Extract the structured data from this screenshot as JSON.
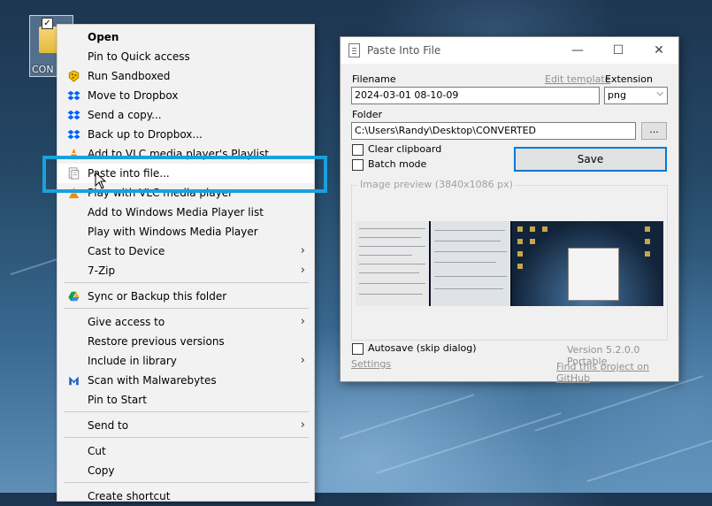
{
  "desktop": {
    "icon_label": "CON"
  },
  "context_menu": {
    "items": [
      {
        "label": "Open",
        "icon": "none"
      },
      {
        "label": "Pin to Quick access",
        "icon": "none"
      },
      {
        "label": "Run Sandboxed",
        "icon": "sandboxie-icon"
      },
      {
        "label": "Move to Dropbox",
        "icon": "dropbox-icon"
      },
      {
        "label": "Send a copy...",
        "icon": "dropbox-icon"
      },
      {
        "label": "Back up to Dropbox...",
        "icon": "dropbox-icon"
      },
      {
        "label": "Add to VLC media player's Playlist",
        "icon": "vlc-icon"
      },
      {
        "label": "Paste into file...",
        "icon": "paste-into-file-icon"
      },
      {
        "label": "Play with VLC media player",
        "icon": "vlc-icon"
      },
      {
        "label": "Add to Windows Media Player list",
        "icon": "none"
      },
      {
        "label": "Play with Windows Media Player",
        "icon": "none"
      },
      {
        "label": "Cast to Device",
        "icon": "none",
        "submenu": true
      },
      {
        "label": "7-Zip",
        "icon": "none",
        "submenu": true
      },
      {
        "label": "Sync or Backup this folder",
        "icon": "google-drive-icon"
      },
      {
        "label": "Give access to",
        "icon": "none",
        "submenu": true
      },
      {
        "label": "Restore previous versions",
        "icon": "none"
      },
      {
        "label": "Include in library",
        "icon": "none",
        "submenu": true
      },
      {
        "label": "Scan with Malwarebytes",
        "icon": "malwarebytes-icon"
      },
      {
        "label": "Pin to Start",
        "icon": "none"
      },
      {
        "label": "Send to",
        "icon": "none",
        "submenu": true
      },
      {
        "label": "Cut",
        "icon": "none"
      },
      {
        "label": "Copy",
        "icon": "none"
      },
      {
        "label": "Create shortcut",
        "icon": "none"
      }
    ],
    "submenu_arrow": "›"
  },
  "dialog": {
    "title": "Paste Into File",
    "minimize": "—",
    "maximize": "☐",
    "close": "✕",
    "filename_label": "Filename",
    "edit_template_link": "Edit template",
    "extension_label": "Extension",
    "filename_value": "2024-03-01 08-10-09",
    "extension_value": "png",
    "folder_label": "Folder",
    "folder_value": "C:\\Users\\Randy\\Desktop\\CONVERTED",
    "browse_label": "...",
    "clear_clipboard_label": "Clear clipboard",
    "batch_mode_label": "Batch mode",
    "save_label": "Save",
    "preview_group_title": "Image preview (3840x1086 px)",
    "autosave_label": "Autosave (skip dialog)",
    "version_text": "Version 5.2.0.0 Portable",
    "settings_link": "Settings",
    "github_link": "Find this project on GitHub",
    "accent_color": "#0078d7"
  },
  "highlight_color": "#1aa0dc"
}
